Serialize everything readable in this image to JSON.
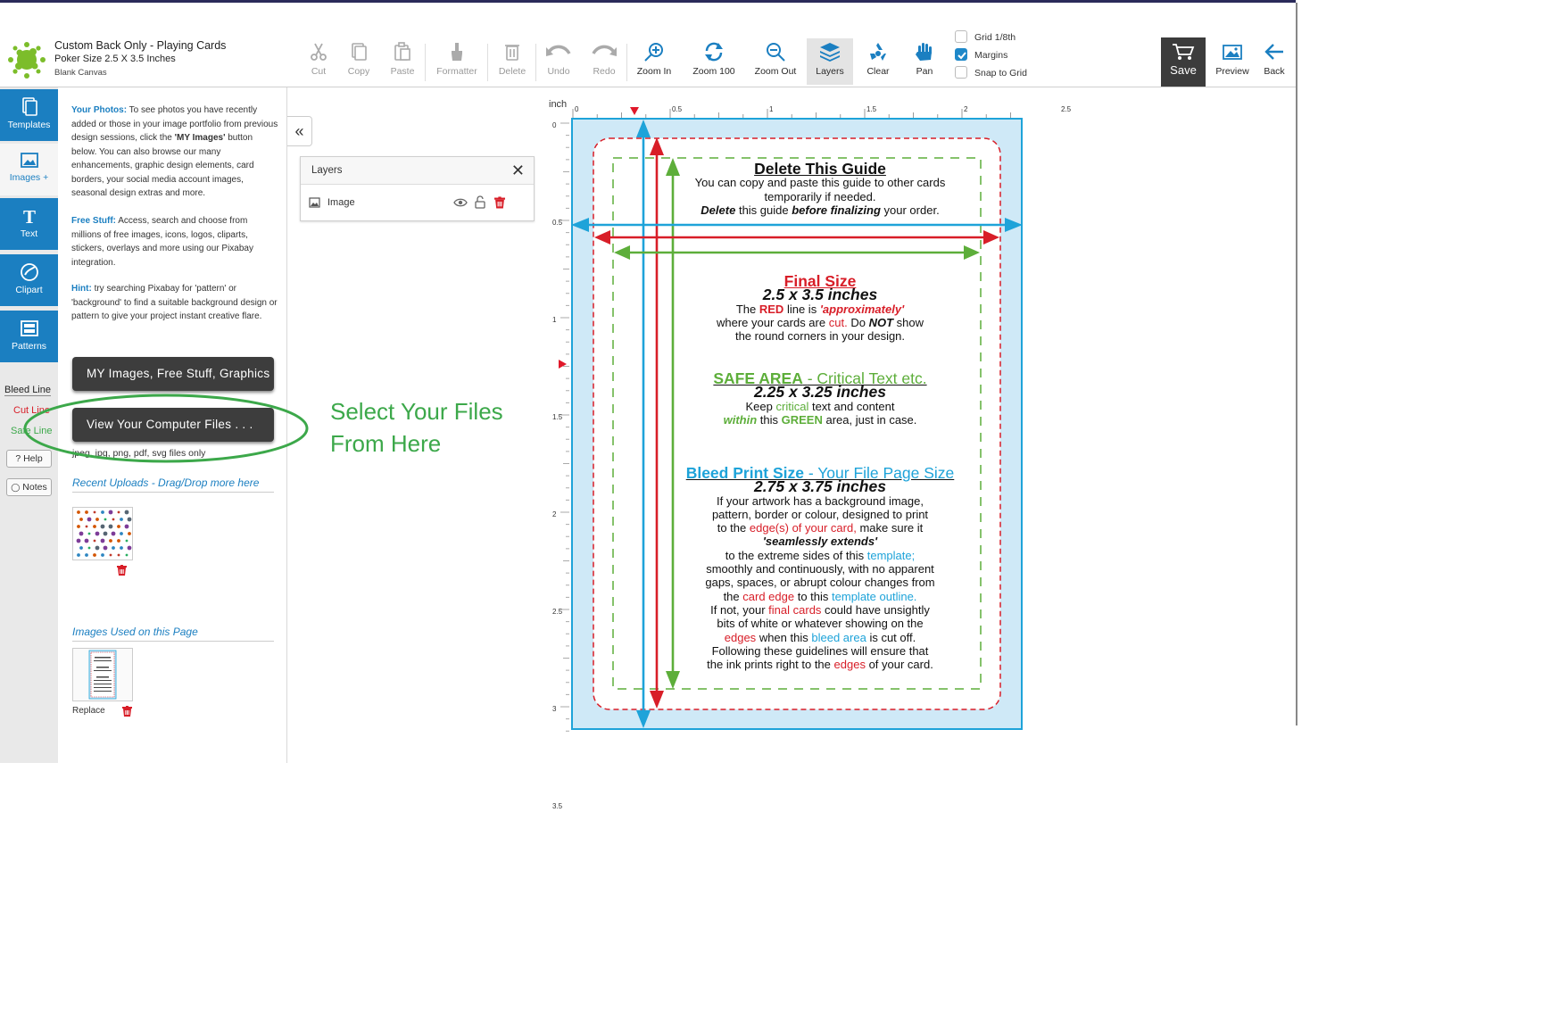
{
  "header": {
    "title": "Custom Back Only - Playing Cards",
    "size": "Poker Size 2.5 X 3.5 Inches",
    "subtitle": "Blank Canvas"
  },
  "toolbar": {
    "cut": "Cut",
    "copy": "Copy",
    "paste": "Paste",
    "formatter": "Formatter",
    "delete": "Delete",
    "undo": "Undo",
    "redo": "Redo",
    "zoom_in": "Zoom In",
    "zoom_100": "Zoom 100",
    "zoom_out": "Zoom Out",
    "layers": "Layers",
    "clear": "Clear",
    "pan": "Pan",
    "grid": "Grid 1/8th",
    "margins": "Margins",
    "snap": "Snap to Grid",
    "grid_checked": false,
    "margins_checked": true,
    "snap_checked": false,
    "save": "Save",
    "preview": "Preview",
    "back": "Back"
  },
  "tabs": {
    "templates": "Templates",
    "images": "Images +",
    "text": "Text",
    "clipart": "Clipart",
    "patterns": "Patterns"
  },
  "guides": {
    "bleed": "Bleed Line",
    "cut": "Cut Line",
    "safe": "Safe Line",
    "help": "Help",
    "notes": "Notes"
  },
  "panel": {
    "photos_head": "Your Photos:",
    "photos_text_a": "To see photos you have recently added or those in your image portfolio from previous design sessions, click the",
    "photos_bold": "'MY Images'",
    "photos_text_b": "button below. You can also browse our many enhancements, graphic design elements, card borders, your social media account images, seasonal design extras and more.",
    "free_head": "Free Stuff:",
    "free_text": "Access, search and choose from millions of free images, icons, logos, cliparts, stickers, overlays and more using our Pixabay integration.",
    "hint_head": "Hint:",
    "hint_text": "try searching Pixabay for 'pattern' or 'background' to find a suitable background design or pattern to give your project instant creative flare.",
    "my_images_btn": "MY Images, Free Stuff, Graphics",
    "computer_files_btn": "View Your Computer Files . . .",
    "file_types": "jpeg, jpg, png, pdf, svg files only",
    "recent_title": "Recent Uploads - Drag/Drop more here",
    "used_title": "Images Used on this Page",
    "replace": "Replace"
  },
  "layers_panel": {
    "title": "Layers",
    "row": "Image"
  },
  "callout": {
    "line1": "Select Your Files",
    "line2": "From Here"
  },
  "ruler": {
    "unit": "inch",
    "top": [
      "0",
      "0.5",
      "1",
      "1.5",
      "2",
      "2.5"
    ],
    "left": [
      "0",
      "0.5",
      "1",
      "1.5",
      "2",
      "2.5",
      "3",
      "3.5"
    ]
  },
  "card": {
    "g_title": "Delete This Guide",
    "g_l1": "You can copy and paste this guide to other cards",
    "g_l2": "temporarily if needed.",
    "g_l3a": "Delete",
    "g_l3b": "this guide",
    "g_l3c": "before finalizing",
    "g_l3d": "your order.",
    "f_title": "Final Size",
    "f_dim": "2.5 x 3.5 inches",
    "f_l1a": "The",
    "f_l1b": "RED",
    "f_l1c": "line is",
    "f_l1d": "'approximately'",
    "f_l2a": "where your cards are",
    "f_l2b": "cut.",
    "f_l2c": "Do",
    "f_l2d": "NOT",
    "f_l2e": "show",
    "f_l3": "the round corners in your design.",
    "s_title": "SAFE AREA",
    "s_title2": "- Critical Text etc.",
    "s_dim": "2.25 x 3.25 inches",
    "s_l1a": "Keep",
    "s_l1b": "critical",
    "s_l1c": "text and content",
    "s_l2a": "within",
    "s_l2b": "this",
    "s_l2c": "GREEN",
    "s_l2d": "area, just in case.",
    "b_title": "Bleed Print Size",
    "b_title2": "- Your File Page Size",
    "b_dim": "2.75 x 3.75 inches",
    "b_1": "If your artwork has a background image,",
    "b_2": "pattern, border or colour, designed to print",
    "b_3a": "to the",
    "b_3b": "edge(s) of your card,",
    "b_3c": "make sure it",
    "b_4": "'seamlessly extends'",
    "b_5a": "to the extreme sides of this",
    "b_5b": "template;",
    "b_6": "smoothly and continuously, with no apparent",
    "b_7": "gaps, spaces, or abrupt colour changes from",
    "b_8a": "the",
    "b_8b": "card edge",
    "b_8c": "to this",
    "b_8d": "template outline.",
    "b_9a": "If not, your",
    "b_9b": "final cards",
    "b_9c": "could have unsightly",
    "b_10": "bits of white or whatever showing on the",
    "b_11a": "edges",
    "b_11b": "when this",
    "b_11c": "bleed area",
    "b_11d": "is cut off.",
    "b_12": "Following these guidelines will ensure that",
    "b_13a": "the ink prints right to the",
    "b_13b": "edges",
    "b_13c": "of your card."
  },
  "colors": {
    "accent": "#1b7fc1",
    "bleed": "#1ea3d9",
    "cut": "#d81e28",
    "safe": "#5dae3a",
    "callout": "#3ca84a"
  }
}
